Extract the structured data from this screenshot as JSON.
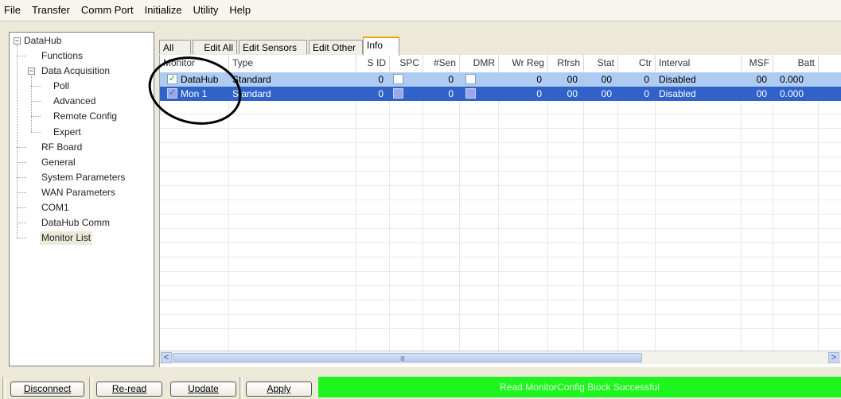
{
  "menu": [
    "File",
    "Transfer",
    "Comm Port",
    "Initialize",
    "Utility",
    "Help"
  ],
  "tree": {
    "root": "DataHub",
    "items": [
      "Functions",
      "Data Acquisition",
      "Poll",
      "Advanced",
      "Remote Config",
      "Expert",
      "RF Board",
      "General",
      "System Parameters",
      "WAN Parameters",
      "COM1",
      "DataHub Comm",
      "Monitor List"
    ],
    "selected": "Monitor List"
  },
  "tabs": [
    "All",
    "Edit All",
    "Edit Sensors",
    "Edit Other",
    "Info"
  ],
  "active_tab": "Info",
  "table": {
    "columns": [
      "Monitor",
      "Type",
      "S ID",
      "SPC",
      "#Sen",
      "DMR",
      "Wr Reg",
      "Rfrsh",
      "Stat",
      "Ctr",
      "Interval",
      "MSF",
      "Batt"
    ],
    "rows": [
      {
        "checked": true,
        "monitor": "DataHub",
        "type": "Standard",
        "sid": "0",
        "spc": false,
        "sen": "0",
        "dmr": false,
        "wrreg": "0",
        "rfrsh": "00",
        "stat": "00",
        "ctr": "0",
        "interval": "Disabled",
        "msf": "00",
        "batt": "0.000",
        "selected": false
      },
      {
        "checked": true,
        "monitor": "Mon 1",
        "type": "Standard",
        "sid": "0",
        "spc": false,
        "sen": "0",
        "dmr": false,
        "wrreg": "0",
        "rfrsh": "00",
        "stat": "00",
        "ctr": "0",
        "interval": "Disabled",
        "msf": "00",
        "batt": "0.000",
        "selected": true
      }
    ]
  },
  "scrollbar": {
    "grip": "IIII",
    "right_arrow": ">",
    "left_arrow": "<"
  },
  "buttons": [
    "Disconnect",
    "Re-read",
    "Update",
    "Apply"
  ],
  "status": "Read MonitorConfig Block Successful",
  "colors": {
    "selection": "#3062c8",
    "row_highlight": "#aecbf2",
    "status_bg": "#1ef41e"
  }
}
